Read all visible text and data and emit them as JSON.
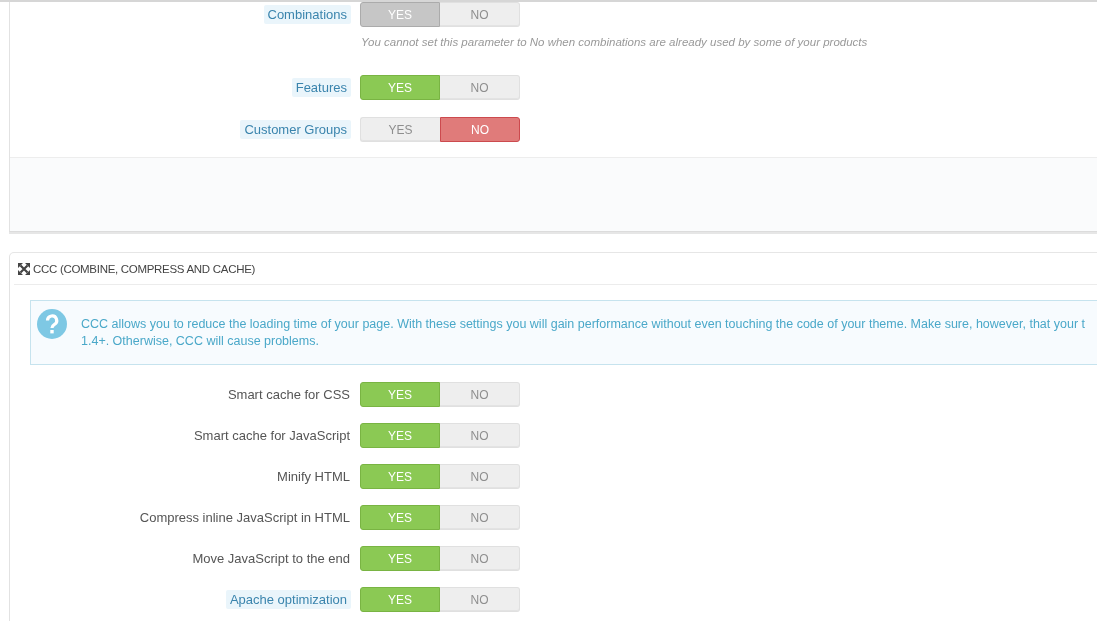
{
  "upper_panel": {
    "settings": [
      {
        "label": "Combinations",
        "hint": true,
        "disabled": true,
        "options": [
          {
            "label": "YES",
            "kind": "yes",
            "selected": true
          },
          {
            "label": "NO",
            "kind": "no",
            "selected": false
          }
        ],
        "help": "You cannot set this parameter to No when combinations are already used by some of your products"
      },
      {
        "label": "Features",
        "hint": true,
        "options": [
          {
            "label": "YES",
            "kind": "yes",
            "selected": true
          },
          {
            "label": "NO",
            "kind": "no",
            "selected": false
          }
        ]
      },
      {
        "label": "Customer Groups",
        "hint": true,
        "options": [
          {
            "label": "YES",
            "kind": "yes",
            "selected": false
          },
          {
            "label": "NO",
            "kind": "no",
            "selected": true
          }
        ]
      }
    ]
  },
  "ccc_panel": {
    "title": "CCC (COMBINE, COMPRESS AND CACHE)",
    "info": "CCC allows you to reduce the loading time of your page. With these settings you will gain performance without even touching the code of your theme. Make sure, however, that your t\n1.4+. Otherwise, CCC will cause problems.",
    "settings": [
      {
        "label": "Smart cache for CSS",
        "hint": false,
        "options": [
          {
            "label": "YES",
            "kind": "yes",
            "selected": true
          },
          {
            "label": "NO",
            "kind": "no",
            "selected": false
          }
        ]
      },
      {
        "label": "Smart cache for JavaScript",
        "hint": false,
        "options": [
          {
            "label": "YES",
            "kind": "yes",
            "selected": true
          },
          {
            "label": "NO",
            "kind": "no",
            "selected": false
          }
        ]
      },
      {
        "label": "Minify HTML",
        "hint": false,
        "options": [
          {
            "label": "YES",
            "kind": "yes",
            "selected": true
          },
          {
            "label": "NO",
            "kind": "no",
            "selected": false
          }
        ]
      },
      {
        "label": "Compress inline JavaScript in HTML",
        "hint": false,
        "options": [
          {
            "label": "YES",
            "kind": "yes",
            "selected": true
          },
          {
            "label": "NO",
            "kind": "no",
            "selected": false
          }
        ]
      },
      {
        "label": "Move JavaScript to the end",
        "hint": false,
        "options": [
          {
            "label": "YES",
            "kind": "yes",
            "selected": true
          },
          {
            "label": "NO",
            "kind": "no",
            "selected": false
          }
        ]
      },
      {
        "label": "Apache optimization",
        "hint": true,
        "options": [
          {
            "label": "YES",
            "kind": "yes",
            "selected": true
          },
          {
            "label": "NO",
            "kind": "no",
            "selected": false
          }
        ]
      }
    ]
  }
}
